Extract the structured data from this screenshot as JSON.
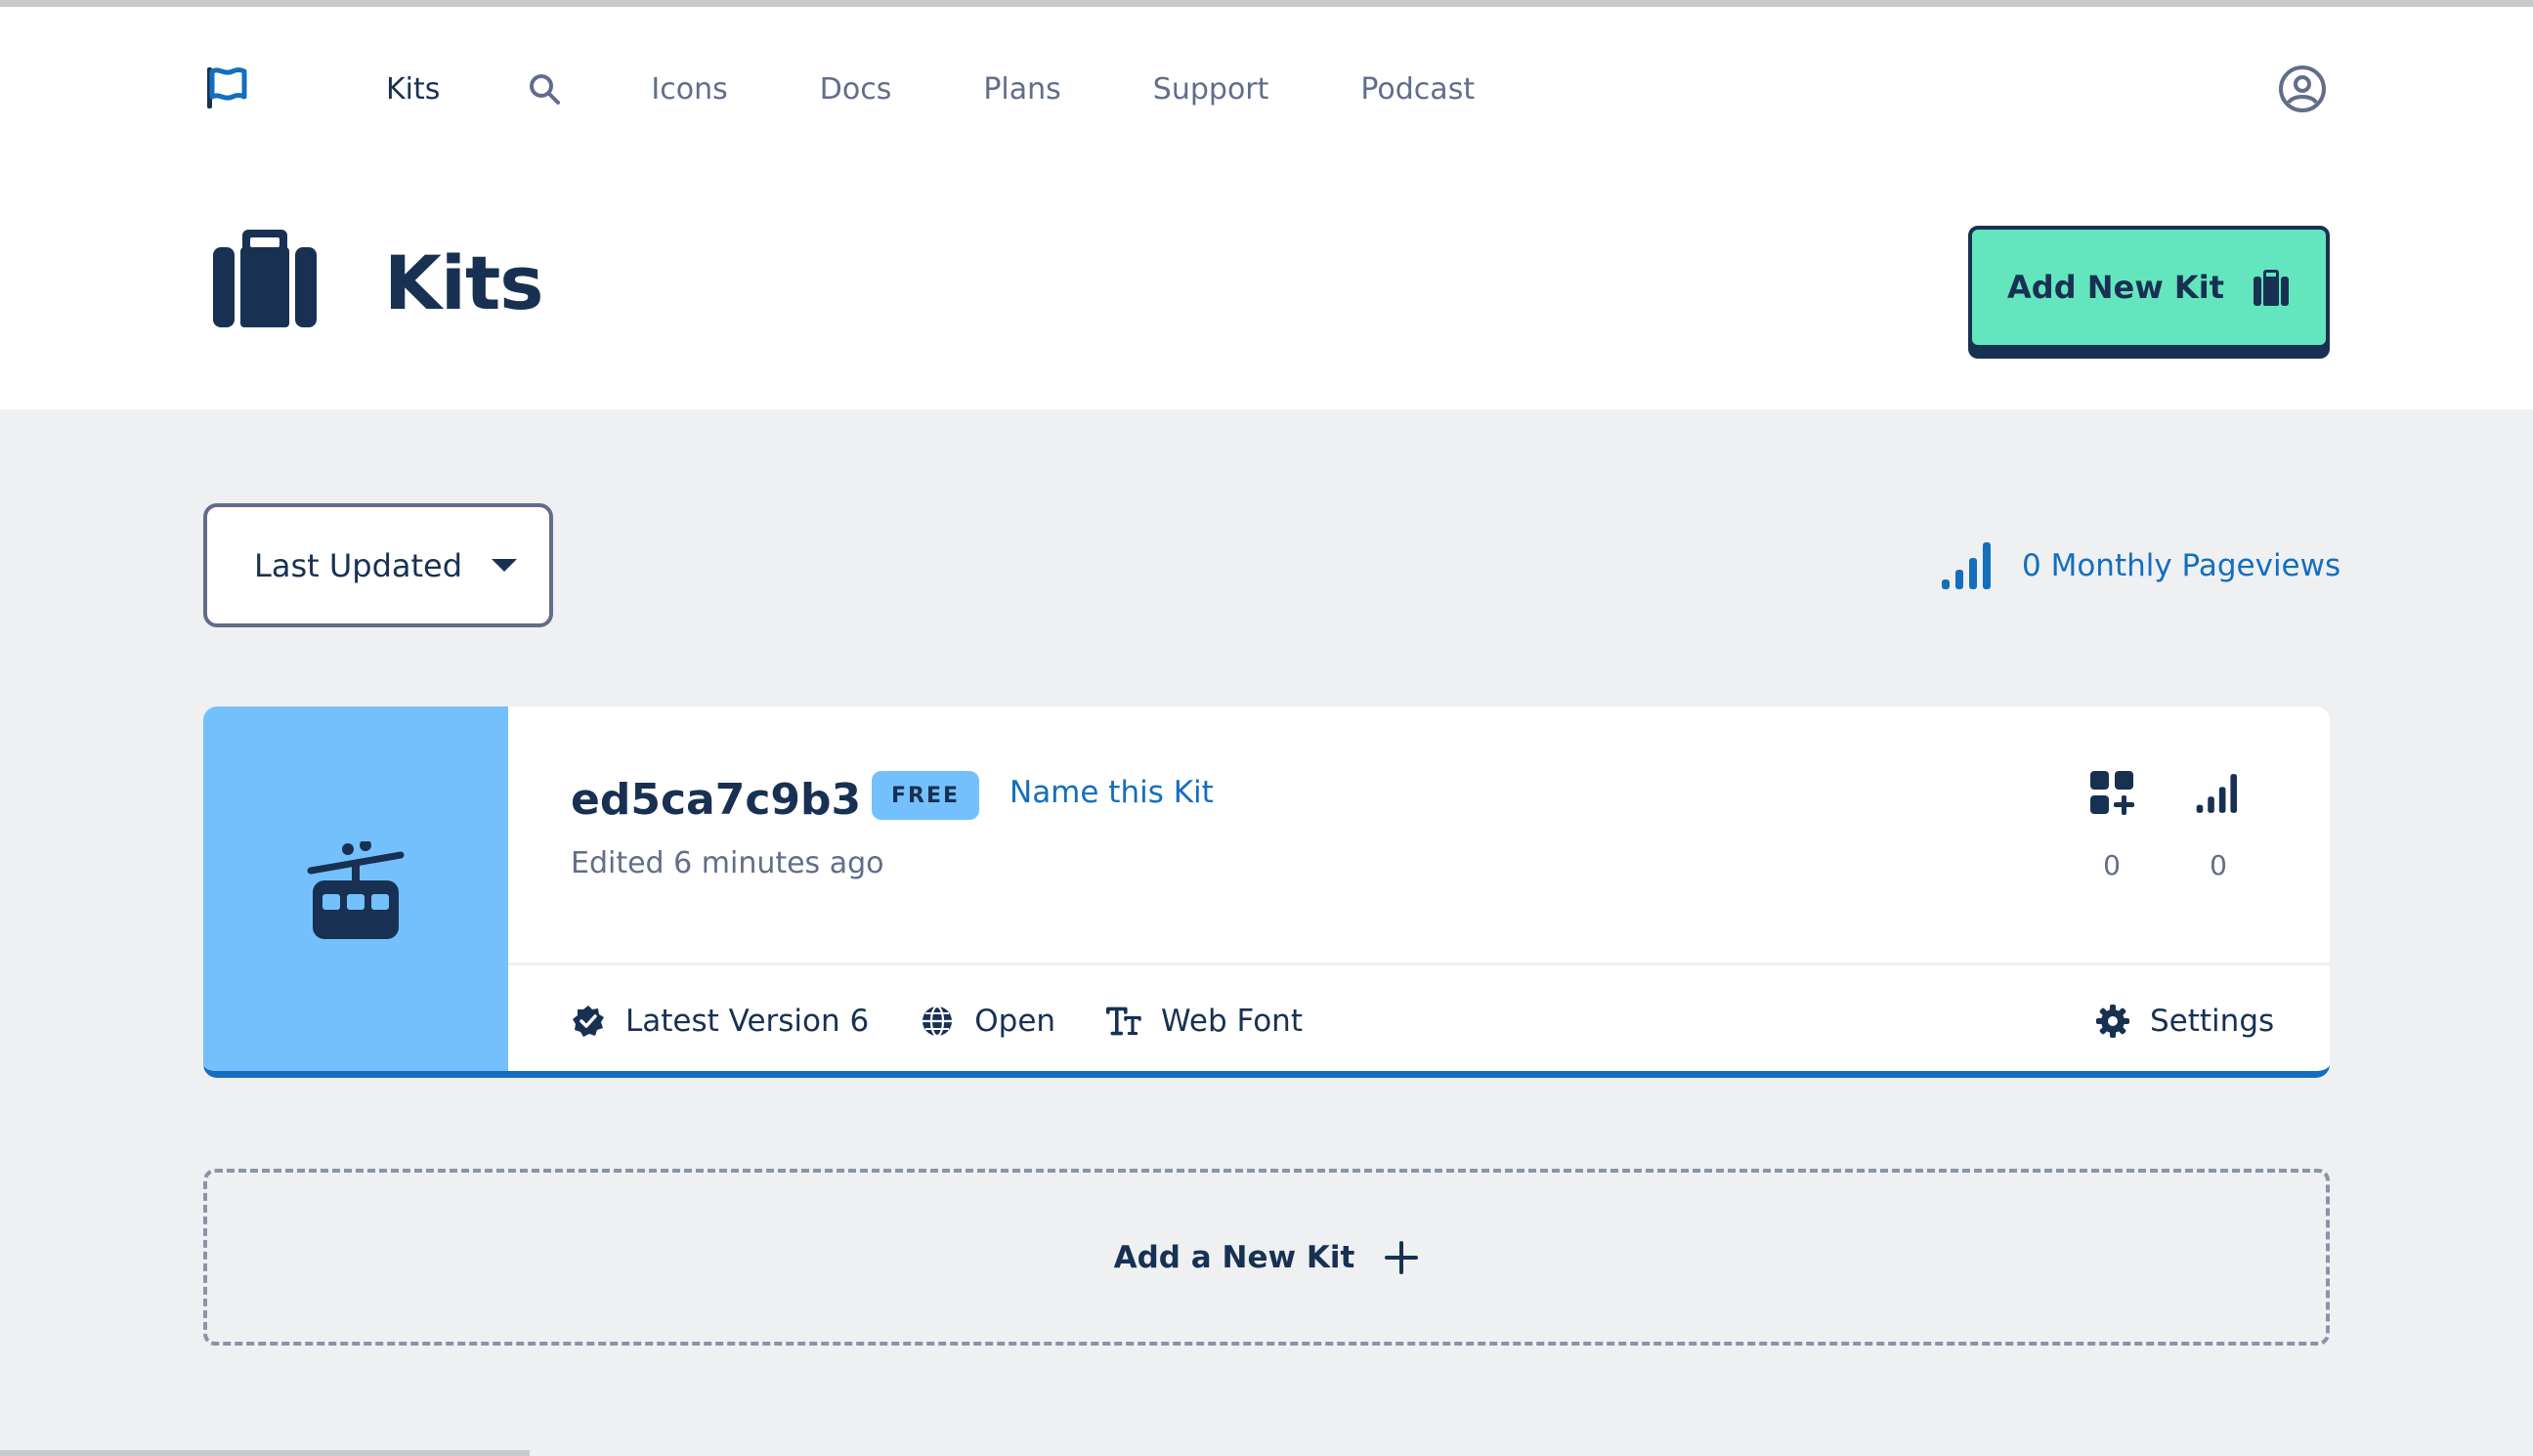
{
  "nav": {
    "items": [
      {
        "label": "Kits",
        "active": true
      },
      {
        "label": "Icons"
      },
      {
        "label": "Docs"
      },
      {
        "label": "Plans"
      },
      {
        "label": "Support"
      },
      {
        "label": "Podcast"
      }
    ]
  },
  "page": {
    "title": "Kits",
    "add_kit_label": "Add New Kit"
  },
  "controls": {
    "sort_selected": "Last Updated",
    "pageviews_label": "0 Monthly Pageviews"
  },
  "kit": {
    "name": "ed5ca7c9b3",
    "plan_badge": "FREE",
    "name_link": "Name this Kit",
    "edited": "Edited 6 minutes ago",
    "icons_count": "0",
    "views_count": "0",
    "version_label": "Latest Version 6",
    "access_label": "Open",
    "tech_label": "Web Font",
    "settings_label": "Settings",
    "thumb_color": "#74c0fc"
  },
  "add_new_kit_dashed": "Add a New Kit",
  "colors": {
    "brand_navy": "#183153",
    "accent_green": "#63e6be",
    "accent_blue": "#146ebe",
    "light_blue": "#74c0fc",
    "bg_gray": "#eff0f2"
  },
  "icons": {
    "logo": "flag-icon",
    "search": "search-icon",
    "account": "user-circle-icon",
    "title": "suitcase-icon",
    "kit_thumb": "cable-car-icon",
    "pageviews": "signal-icon",
    "icons_stat": "grid-plus-icon",
    "version": "badge-check-icon",
    "access": "globe-icon",
    "tech": "text-size-icon",
    "settings": "gear-icon",
    "add": "plus-icon"
  }
}
